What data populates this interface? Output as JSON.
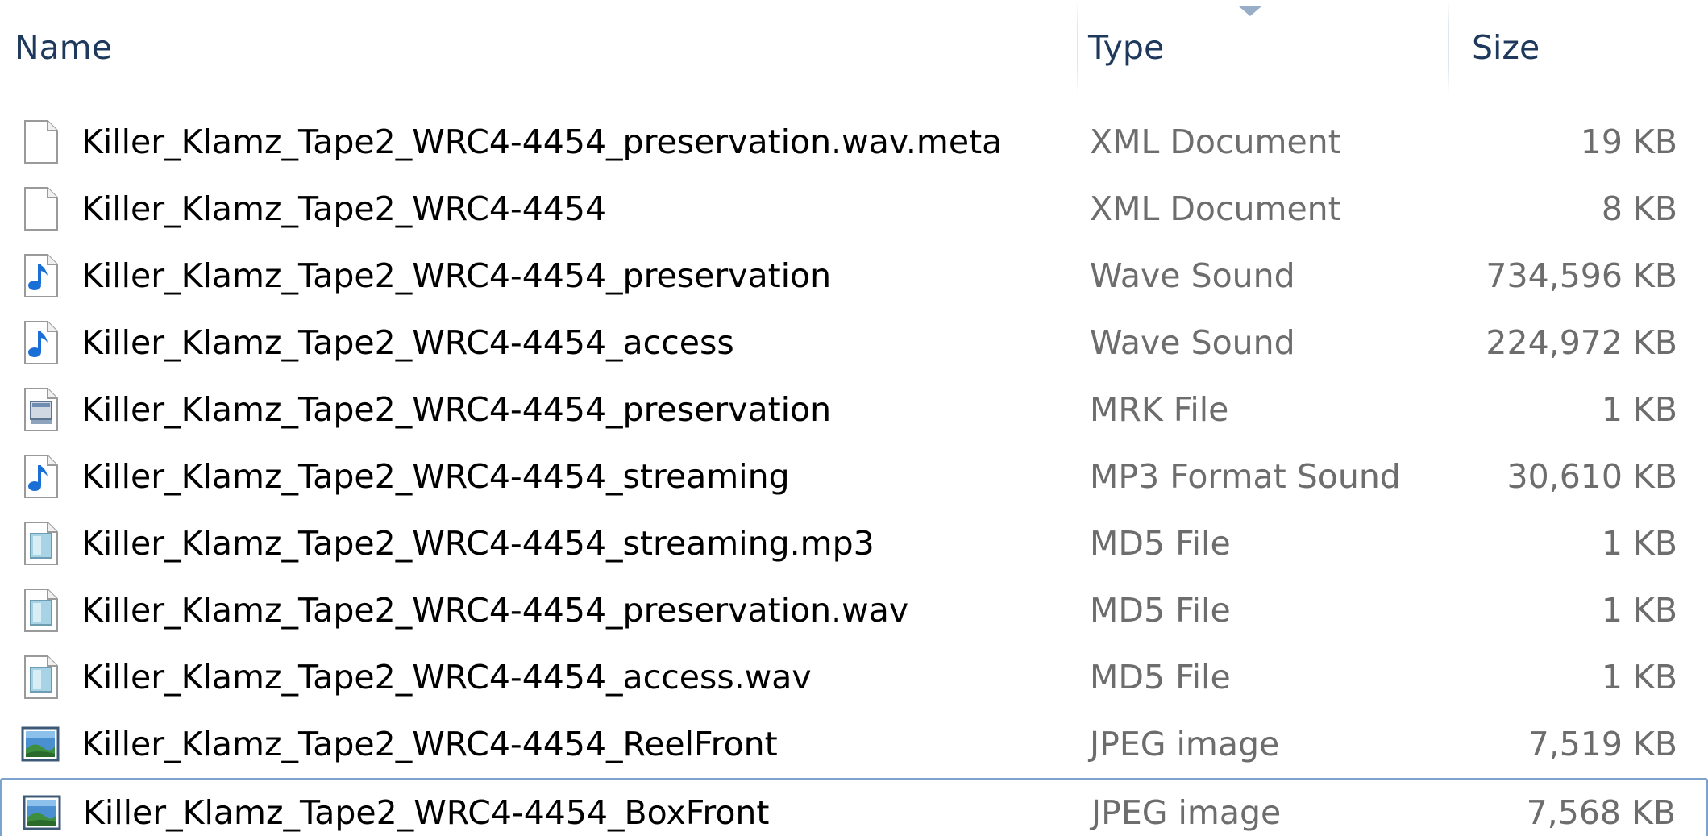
{
  "columns": {
    "name": "Name",
    "type": "Type",
    "size": "Size"
  },
  "sort": {
    "column": "Type",
    "direction": "ascending"
  },
  "colors": {
    "header_text": "#1e395b",
    "name_text": "#000000",
    "meta_text": "#6d6d6d",
    "focus_border": "#7da2ce"
  },
  "files": [
    {
      "name": "Killer_Klamz_Tape2_WRC4-4454_preservation.wav.meta",
      "type": "XML Document",
      "size": "19 KB",
      "icon": "blank-document-icon"
    },
    {
      "name": "Killer_Klamz_Tape2_WRC4-4454",
      "type": "XML Document",
      "size": "8 KB",
      "icon": "blank-document-icon"
    },
    {
      "name": "Killer_Klamz_Tape2_WRC4-4454_preservation",
      "type": "Wave Sound",
      "size": "734,596 KB",
      "icon": "music-note-icon"
    },
    {
      "name": "Killer_Klamz_Tape2_WRC4-4454_access",
      "type": "Wave Sound",
      "size": "224,972 KB",
      "icon": "music-note-icon"
    },
    {
      "name": "Killer_Klamz_Tape2_WRC4-4454_preservation",
      "type": "MRK File",
      "size": "1 KB",
      "icon": "application-file-icon"
    },
    {
      "name": "Killer_Klamz_Tape2_WRC4-4454_streaming",
      "type": "MP3 Format Sound",
      "size": "30,610 KB",
      "icon": "music-note-icon"
    },
    {
      "name": "Killer_Klamz_Tape2_WRC4-4454_streaming.mp3",
      "type": "MD5 File",
      "size": "1 KB",
      "icon": "generic-file-icon"
    },
    {
      "name": "Killer_Klamz_Tape2_WRC4-4454_preservation.wav",
      "type": "MD5 File",
      "size": "1 KB",
      "icon": "generic-file-icon"
    },
    {
      "name": "Killer_Klamz_Tape2_WRC4-4454_access.wav",
      "type": "MD5 File",
      "size": "1 KB",
      "icon": "generic-file-icon"
    },
    {
      "name": "Killer_Klamz_Tape2_WRC4-4454_ReelFront",
      "type": "JPEG image",
      "size": "7,519 KB",
      "icon": "image-file-icon"
    },
    {
      "name": "Killer_Klamz_Tape2_WRC4-4454_BoxFront",
      "type": "JPEG image",
      "size": "7,568 KB",
      "icon": "image-file-icon",
      "focused": true
    }
  ]
}
